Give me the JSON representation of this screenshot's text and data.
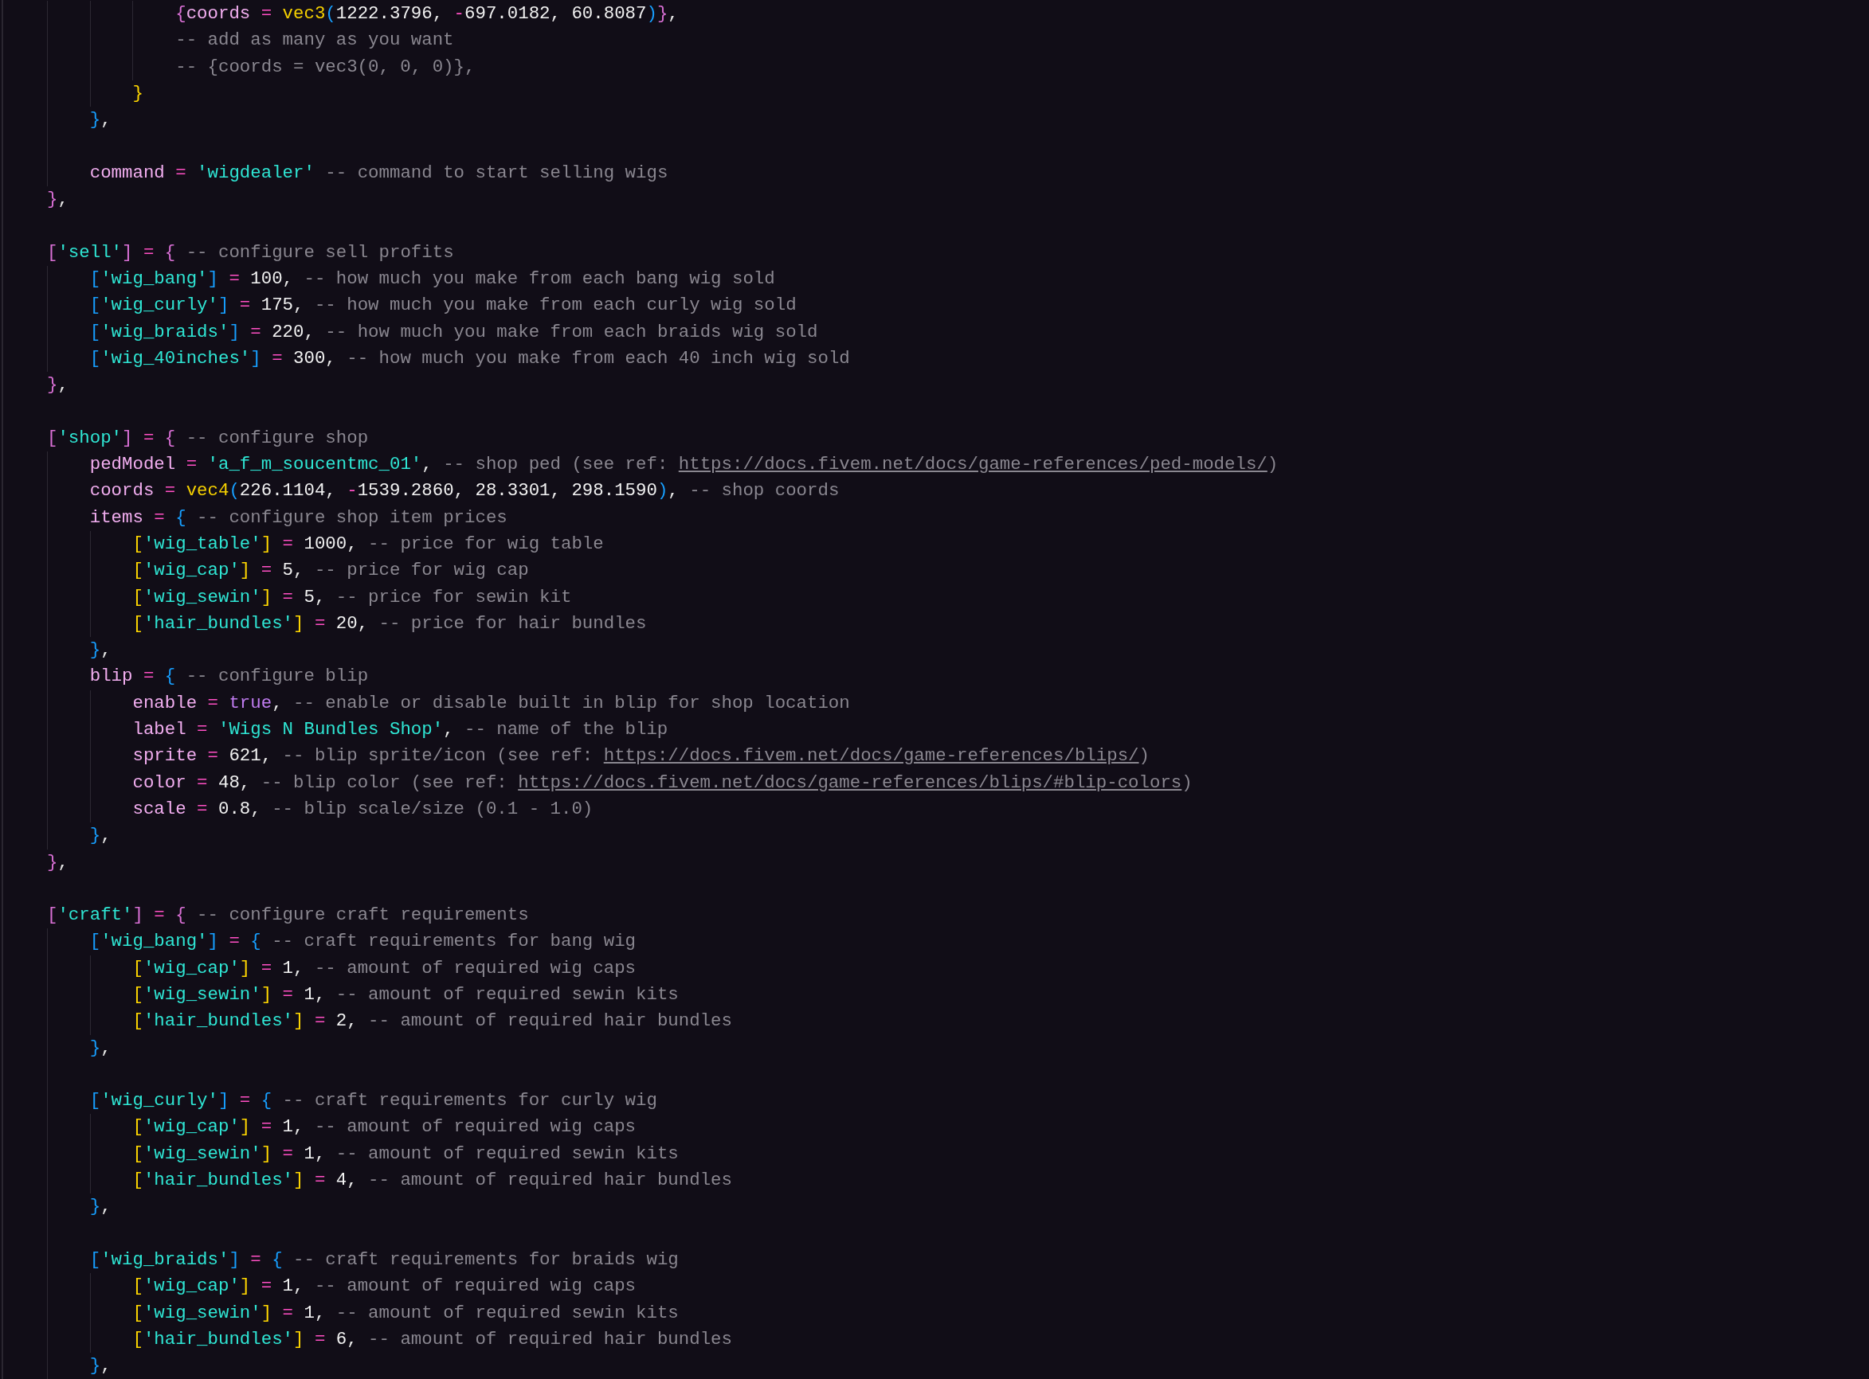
{
  "code": [
    {
      "children": [
        {
          "children": [
            {
              "children": [
                {
                  "tokens": [
                    {
                      "kind": "bracket",
                      "text": "{",
                      "color": "#da70d6"
                    },
                    {
                      "kind": "key",
                      "text": "coords"
                    },
                    {
                      "kind": "op",
                      "text": " = "
                    },
                    {
                      "kind": "func",
                      "text": "vec3"
                    },
                    {
                      "kind": "bracket",
                      "text": "(",
                      "color": "#179fff"
                    },
                    {
                      "kind": "num",
                      "text": "1222.3796"
                    },
                    {
                      "kind": "punct",
                      "text": ", "
                    },
                    {
                      "kind": "op",
                      "text": "-"
                    },
                    {
                      "kind": "num",
                      "text": "697.0182"
                    },
                    {
                      "kind": "punct",
                      "text": ", "
                    },
                    {
                      "kind": "num",
                      "text": "60.8087"
                    },
                    {
                      "kind": "bracket",
                      "text": ")",
                      "color": "#179fff"
                    },
                    {
                      "kind": "bracket",
                      "text": "}",
                      "color": "#da70d6"
                    },
                    {
                      "kind": "punct",
                      "text": ","
                    }
                  ]
                },
                {
                  "tokens": [
                    {
                      "kind": "comment",
                      "text": "-- add as many as you want"
                    }
                  ]
                },
                {
                  "tokens": [
                    {
                      "kind": "comment",
                      "text": "-- {coords = vec3(0, 0, 0)},"
                    }
                  ]
                }
              ]
            },
            {
              "tokens": [
                {
                  "kind": "bracket",
                  "text": "}",
                  "color": "#ffd700"
                }
              ]
            }
          ]
        },
        {
          "tokens": [
            {
              "kind": "bracket",
              "text": "}",
              "color": "#179fff"
            },
            {
              "kind": "punct",
              "text": ","
            }
          ]
        },
        {
          "kind": "blank"
        },
        {
          "tokens": [
            {
              "kind": "key",
              "text": "command"
            },
            {
              "kind": "op",
              "text": " = "
            },
            {
              "kind": "str",
              "text": "'wigdealer'"
            },
            {
              "kind": "comment",
              "text": " -- command to start selling wigs"
            }
          ]
        }
      ]
    },
    {
      "tokens": [
        {
          "kind": "bracket",
          "text": "}",
          "color": "#da70d6"
        },
        {
          "kind": "punct",
          "text": ","
        }
      ]
    },
    {
      "kind": "blank"
    },
    {
      "tokens": [
        {
          "kind": "bracket",
          "text": "[",
          "color": "#da70d6"
        },
        {
          "kind": "str",
          "text": "'sell'"
        },
        {
          "kind": "bracket",
          "text": "]",
          "color": "#da70d6"
        },
        {
          "kind": "op",
          "text": " = "
        },
        {
          "kind": "bracket",
          "text": "{",
          "color": "#da70d6"
        },
        {
          "kind": "comment",
          "text": " -- configure sell profits"
        }
      ],
      "children": [
        {
          "tokens": [
            {
              "kind": "bracket",
              "text": "[",
              "color": "#179fff"
            },
            {
              "kind": "str",
              "text": "'wig_bang'"
            },
            {
              "kind": "bracket",
              "text": "]",
              "color": "#179fff"
            },
            {
              "kind": "op",
              "text": " = "
            },
            {
              "kind": "num",
              "text": "100"
            },
            {
              "kind": "punct",
              "text": ","
            },
            {
              "kind": "comment",
              "text": " -- how much you make from each bang wig sold"
            }
          ]
        },
        {
          "tokens": [
            {
              "kind": "bracket",
              "text": "[",
              "color": "#179fff"
            },
            {
              "kind": "str",
              "text": "'wig_curly'"
            },
            {
              "kind": "bracket",
              "text": "]",
              "color": "#179fff"
            },
            {
              "kind": "op",
              "text": " = "
            },
            {
              "kind": "num",
              "text": "175"
            },
            {
              "kind": "punct",
              "text": ","
            },
            {
              "kind": "comment",
              "text": " -- how much you make from each curly wig sold"
            }
          ]
        },
        {
          "tokens": [
            {
              "kind": "bracket",
              "text": "[",
              "color": "#179fff"
            },
            {
              "kind": "str",
              "text": "'wig_braids'"
            },
            {
              "kind": "bracket",
              "text": "]",
              "color": "#179fff"
            },
            {
              "kind": "op",
              "text": " = "
            },
            {
              "kind": "num",
              "text": "220"
            },
            {
              "kind": "punct",
              "text": ","
            },
            {
              "kind": "comment",
              "text": " -- how much you make from each braids wig sold"
            }
          ]
        },
        {
          "tokens": [
            {
              "kind": "bracket",
              "text": "[",
              "color": "#179fff"
            },
            {
              "kind": "str",
              "text": "'wig_40inches'"
            },
            {
              "kind": "bracket",
              "text": "]",
              "color": "#179fff"
            },
            {
              "kind": "op",
              "text": " = "
            },
            {
              "kind": "num",
              "text": "300"
            },
            {
              "kind": "punct",
              "text": ","
            },
            {
              "kind": "comment",
              "text": " -- how much you make from each 40 inch wig sold"
            }
          ]
        }
      ]
    },
    {
      "tokens": [
        {
          "kind": "bracket",
          "text": "}",
          "color": "#da70d6"
        },
        {
          "kind": "punct",
          "text": ","
        }
      ]
    },
    {
      "kind": "blank"
    },
    {
      "tokens": [
        {
          "kind": "bracket",
          "text": "[",
          "color": "#da70d6"
        },
        {
          "kind": "str",
          "text": "'shop'"
        },
        {
          "kind": "bracket",
          "text": "]",
          "color": "#da70d6"
        },
        {
          "kind": "op",
          "text": " = "
        },
        {
          "kind": "bracket",
          "text": "{",
          "color": "#da70d6"
        },
        {
          "kind": "comment",
          "text": " -- configure shop"
        }
      ],
      "children": [
        {
          "tokens": [
            {
              "kind": "key",
              "text": "pedModel"
            },
            {
              "kind": "op",
              "text": " = "
            },
            {
              "kind": "str",
              "text": "'a_f_m_soucentmc_01'"
            },
            {
              "kind": "punct",
              "text": ","
            },
            {
              "kind": "comment",
              "text": " -- shop ped (see ref: "
            },
            {
              "kind": "link",
              "text": "https://docs.fivem.net/docs/game-references/ped-models/"
            },
            {
              "kind": "comment",
              "text": ")"
            }
          ]
        },
        {
          "tokens": [
            {
              "kind": "key",
              "text": "coords"
            },
            {
              "kind": "op",
              "text": " = "
            },
            {
              "kind": "func",
              "text": "vec4"
            },
            {
              "kind": "bracket",
              "text": "(",
              "color": "#179fff"
            },
            {
              "kind": "num",
              "text": "226.1104"
            },
            {
              "kind": "punct",
              "text": ", "
            },
            {
              "kind": "op",
              "text": "-"
            },
            {
              "kind": "num",
              "text": "1539.2860"
            },
            {
              "kind": "punct",
              "text": ", "
            },
            {
              "kind": "num",
              "text": "28.3301"
            },
            {
              "kind": "punct",
              "text": ", "
            },
            {
              "kind": "num",
              "text": "298.1590"
            },
            {
              "kind": "bracket",
              "text": ")",
              "color": "#179fff"
            },
            {
              "kind": "punct",
              "text": ","
            },
            {
              "kind": "comment",
              "text": " -- shop coords"
            }
          ]
        },
        {
          "tokens": [
            {
              "kind": "key",
              "text": "items"
            },
            {
              "kind": "op",
              "text": " = "
            },
            {
              "kind": "bracket",
              "text": "{",
              "color": "#179fff"
            },
            {
              "kind": "comment",
              "text": " -- configure shop item prices"
            }
          ],
          "children": [
            {
              "tokens": [
                {
                  "kind": "bracket",
                  "text": "[",
                  "color": "#ffd700"
                },
                {
                  "kind": "str",
                  "text": "'wig_table'"
                },
                {
                  "kind": "bracket",
                  "text": "]",
                  "color": "#ffd700"
                },
                {
                  "kind": "op",
                  "text": " = "
                },
                {
                  "kind": "num",
                  "text": "1000"
                },
                {
                  "kind": "punct",
                  "text": ","
                },
                {
                  "kind": "comment",
                  "text": " -- price for wig table"
                }
              ]
            },
            {
              "tokens": [
                {
                  "kind": "bracket",
                  "text": "[",
                  "color": "#ffd700"
                },
                {
                  "kind": "str",
                  "text": "'wig_cap'"
                },
                {
                  "kind": "bracket",
                  "text": "]",
                  "color": "#ffd700"
                },
                {
                  "kind": "op",
                  "text": " = "
                },
                {
                  "kind": "num",
                  "text": "5"
                },
                {
                  "kind": "punct",
                  "text": ","
                },
                {
                  "kind": "comment",
                  "text": " -- price for wig cap"
                }
              ]
            },
            {
              "tokens": [
                {
                  "kind": "bracket",
                  "text": "[",
                  "color": "#ffd700"
                },
                {
                  "kind": "str",
                  "text": "'wig_sewin'"
                },
                {
                  "kind": "bracket",
                  "text": "]",
                  "color": "#ffd700"
                },
                {
                  "kind": "op",
                  "text": " = "
                },
                {
                  "kind": "num",
                  "text": "5"
                },
                {
                  "kind": "punct",
                  "text": ","
                },
                {
                  "kind": "comment",
                  "text": " -- price for sewin kit"
                }
              ]
            },
            {
              "tokens": [
                {
                  "kind": "bracket",
                  "text": "[",
                  "color": "#ffd700"
                },
                {
                  "kind": "str",
                  "text": "'hair_bundles'"
                },
                {
                  "kind": "bracket",
                  "text": "]",
                  "color": "#ffd700"
                },
                {
                  "kind": "op",
                  "text": " = "
                },
                {
                  "kind": "num",
                  "text": "20"
                },
                {
                  "kind": "punct",
                  "text": ","
                },
                {
                  "kind": "comment",
                  "text": " -- price for hair bundles"
                }
              ]
            }
          ]
        },
        {
          "tokens": [
            {
              "kind": "bracket",
              "text": "}",
              "color": "#179fff"
            },
            {
              "kind": "punct",
              "text": ","
            }
          ]
        },
        {
          "tokens": [
            {
              "kind": "key",
              "text": "blip"
            },
            {
              "kind": "op",
              "text": " = "
            },
            {
              "kind": "bracket",
              "text": "{",
              "color": "#179fff"
            },
            {
              "kind": "comment",
              "text": " -- configure blip"
            }
          ],
          "children": [
            {
              "tokens": [
                {
                  "kind": "key",
                  "text": "enable"
                },
                {
                  "kind": "op",
                  "text": " = "
                },
                {
                  "kind": "bool",
                  "text": "true"
                },
                {
                  "kind": "punct",
                  "text": ","
                },
                {
                  "kind": "comment",
                  "text": " -- enable or disable built in blip for shop location"
                }
              ]
            },
            {
              "tokens": [
                {
                  "kind": "key",
                  "text": "label"
                },
                {
                  "kind": "op",
                  "text": " = "
                },
                {
                  "kind": "str",
                  "text": "'Wigs N Bundles Shop'"
                },
                {
                  "kind": "punct",
                  "text": ","
                },
                {
                  "kind": "comment",
                  "text": " -- name of the blip"
                }
              ]
            },
            {
              "tokens": [
                {
                  "kind": "key",
                  "text": "sprite"
                },
                {
                  "kind": "op",
                  "text": " = "
                },
                {
                  "kind": "num",
                  "text": "621"
                },
                {
                  "kind": "punct",
                  "text": ","
                },
                {
                  "kind": "comment",
                  "text": " -- blip sprite/icon (see ref: "
                },
                {
                  "kind": "link",
                  "text": "https://docs.fivem.net/docs/game-references/blips/"
                },
                {
                  "kind": "comment",
                  "text": ")"
                }
              ]
            },
            {
              "tokens": [
                {
                  "kind": "key",
                  "text": "color"
                },
                {
                  "kind": "op",
                  "text": " = "
                },
                {
                  "kind": "num",
                  "text": "48"
                },
                {
                  "kind": "punct",
                  "text": ","
                },
                {
                  "kind": "comment",
                  "text": " -- blip color (see ref: "
                },
                {
                  "kind": "link",
                  "text": "https://docs.fivem.net/docs/game-references/blips/#blip-colors"
                },
                {
                  "kind": "comment",
                  "text": ")"
                }
              ]
            },
            {
              "tokens": [
                {
                  "kind": "key",
                  "text": "scale"
                },
                {
                  "kind": "op",
                  "text": " = "
                },
                {
                  "kind": "num",
                  "text": "0.8"
                },
                {
                  "kind": "punct",
                  "text": ","
                },
                {
                  "kind": "comment",
                  "text": " -- blip scale/size (0.1 - 1.0)"
                }
              ]
            }
          ]
        },
        {
          "tokens": [
            {
              "kind": "bracket",
              "text": "}",
              "color": "#179fff"
            },
            {
              "kind": "punct",
              "text": ","
            }
          ]
        }
      ]
    },
    {
      "tokens": [
        {
          "kind": "bracket",
          "text": "}",
          "color": "#da70d6"
        },
        {
          "kind": "punct",
          "text": ","
        }
      ]
    },
    {
      "kind": "blank"
    },
    {
      "tokens": [
        {
          "kind": "bracket",
          "text": "[",
          "color": "#da70d6"
        },
        {
          "kind": "str",
          "text": "'craft'"
        },
        {
          "kind": "bracket",
          "text": "]",
          "color": "#da70d6"
        },
        {
          "kind": "op",
          "text": " = "
        },
        {
          "kind": "bracket",
          "text": "{",
          "color": "#da70d6"
        },
        {
          "kind": "comment",
          "text": " -- configure craft requirements"
        }
      ],
      "children": [
        {
          "tokens": [
            {
              "kind": "bracket",
              "text": "[",
              "color": "#179fff"
            },
            {
              "kind": "str",
              "text": "'wig_bang'"
            },
            {
              "kind": "bracket",
              "text": "]",
              "color": "#179fff"
            },
            {
              "kind": "op",
              "text": " = "
            },
            {
              "kind": "bracket",
              "text": "{",
              "color": "#179fff"
            },
            {
              "kind": "comment",
              "text": " -- craft requirements for bang wig"
            }
          ],
          "children": [
            {
              "tokens": [
                {
                  "kind": "bracket",
                  "text": "[",
                  "color": "#ffd700"
                },
                {
                  "kind": "str",
                  "text": "'wig_cap'"
                },
                {
                  "kind": "bracket",
                  "text": "]",
                  "color": "#ffd700"
                },
                {
                  "kind": "op",
                  "text": " = "
                },
                {
                  "kind": "num",
                  "text": "1"
                },
                {
                  "kind": "punct",
                  "text": ","
                },
                {
                  "kind": "comment",
                  "text": " -- amount of required wig caps"
                }
              ]
            },
            {
              "tokens": [
                {
                  "kind": "bracket",
                  "text": "[",
                  "color": "#ffd700"
                },
                {
                  "kind": "str",
                  "text": "'wig_sewin'"
                },
                {
                  "kind": "bracket",
                  "text": "]",
                  "color": "#ffd700"
                },
                {
                  "kind": "op",
                  "text": " = "
                },
                {
                  "kind": "num",
                  "text": "1"
                },
                {
                  "kind": "punct",
                  "text": ","
                },
                {
                  "kind": "comment",
                  "text": " -- amount of required sewin kits"
                }
              ]
            },
            {
              "tokens": [
                {
                  "kind": "bracket",
                  "text": "[",
                  "color": "#ffd700"
                },
                {
                  "kind": "str",
                  "text": "'hair_bundles'"
                },
                {
                  "kind": "bracket",
                  "text": "]",
                  "color": "#ffd700"
                },
                {
                  "kind": "op",
                  "text": " = "
                },
                {
                  "kind": "num",
                  "text": "2"
                },
                {
                  "kind": "punct",
                  "text": ","
                },
                {
                  "kind": "comment",
                  "text": " -- amount of required hair bundles"
                }
              ]
            }
          ]
        },
        {
          "tokens": [
            {
              "kind": "bracket",
              "text": "}",
              "color": "#179fff"
            },
            {
              "kind": "punct",
              "text": ","
            }
          ]
        },
        {
          "kind": "blank"
        },
        {
          "tokens": [
            {
              "kind": "bracket",
              "text": "[",
              "color": "#179fff"
            },
            {
              "kind": "str",
              "text": "'wig_curly'"
            },
            {
              "kind": "bracket",
              "text": "]",
              "color": "#179fff"
            },
            {
              "kind": "op",
              "text": " = "
            },
            {
              "kind": "bracket",
              "text": "{",
              "color": "#179fff"
            },
            {
              "kind": "comment",
              "text": " -- craft requirements for curly wig"
            }
          ],
          "children": [
            {
              "tokens": [
                {
                  "kind": "bracket",
                  "text": "[",
                  "color": "#ffd700"
                },
                {
                  "kind": "str",
                  "text": "'wig_cap'"
                },
                {
                  "kind": "bracket",
                  "text": "]",
                  "color": "#ffd700"
                },
                {
                  "kind": "op",
                  "text": " = "
                },
                {
                  "kind": "num",
                  "text": "1"
                },
                {
                  "kind": "punct",
                  "text": ","
                },
                {
                  "kind": "comment",
                  "text": " -- amount of required wig caps"
                }
              ]
            },
            {
              "tokens": [
                {
                  "kind": "bracket",
                  "text": "[",
                  "color": "#ffd700"
                },
                {
                  "kind": "str",
                  "text": "'wig_sewin'"
                },
                {
                  "kind": "bracket",
                  "text": "]",
                  "color": "#ffd700"
                },
                {
                  "kind": "op",
                  "text": " = "
                },
                {
                  "kind": "num",
                  "text": "1"
                },
                {
                  "kind": "punct",
                  "text": ","
                },
                {
                  "kind": "comment",
                  "text": " -- amount of required sewin kits"
                }
              ]
            },
            {
              "tokens": [
                {
                  "kind": "bracket",
                  "text": "[",
                  "color": "#ffd700"
                },
                {
                  "kind": "str",
                  "text": "'hair_bundles'"
                },
                {
                  "kind": "bracket",
                  "text": "]",
                  "color": "#ffd700"
                },
                {
                  "kind": "op",
                  "text": " = "
                },
                {
                  "kind": "num",
                  "text": "4"
                },
                {
                  "kind": "punct",
                  "text": ","
                },
                {
                  "kind": "comment",
                  "text": " -- amount of required hair bundles"
                }
              ]
            }
          ]
        },
        {
          "tokens": [
            {
              "kind": "bracket",
              "text": "}",
              "color": "#179fff"
            },
            {
              "kind": "punct",
              "text": ","
            }
          ]
        },
        {
          "kind": "blank"
        },
        {
          "tokens": [
            {
              "kind": "bracket",
              "text": "[",
              "color": "#179fff"
            },
            {
              "kind": "str",
              "text": "'wig_braids'"
            },
            {
              "kind": "bracket",
              "text": "]",
              "color": "#179fff"
            },
            {
              "kind": "op",
              "text": " = "
            },
            {
              "kind": "bracket",
              "text": "{",
              "color": "#179fff"
            },
            {
              "kind": "comment",
              "text": " -- craft requirements for braids wig"
            }
          ],
          "children": [
            {
              "tokens": [
                {
                  "kind": "bracket",
                  "text": "[",
                  "color": "#ffd700"
                },
                {
                  "kind": "str",
                  "text": "'wig_cap'"
                },
                {
                  "kind": "bracket",
                  "text": "]",
                  "color": "#ffd700"
                },
                {
                  "kind": "op",
                  "text": " = "
                },
                {
                  "kind": "num",
                  "text": "1"
                },
                {
                  "kind": "punct",
                  "text": ","
                },
                {
                  "kind": "comment",
                  "text": " -- amount of required wig caps"
                }
              ]
            },
            {
              "tokens": [
                {
                  "kind": "bracket",
                  "text": "[",
                  "color": "#ffd700"
                },
                {
                  "kind": "str",
                  "text": "'wig_sewin'"
                },
                {
                  "kind": "bracket",
                  "text": "]",
                  "color": "#ffd700"
                },
                {
                  "kind": "op",
                  "text": " = "
                },
                {
                  "kind": "num",
                  "text": "1"
                },
                {
                  "kind": "punct",
                  "text": ","
                },
                {
                  "kind": "comment",
                  "text": " -- amount of required sewin kits"
                }
              ]
            },
            {
              "tokens": [
                {
                  "kind": "bracket",
                  "text": "[",
                  "color": "#ffd700"
                },
                {
                  "kind": "str",
                  "text": "'hair_bundles'"
                },
                {
                  "kind": "bracket",
                  "text": "]",
                  "color": "#ffd700"
                },
                {
                  "kind": "op",
                  "text": " = "
                },
                {
                  "kind": "num",
                  "text": "6"
                },
                {
                  "kind": "punct",
                  "text": ","
                },
                {
                  "kind": "comment",
                  "text": " -- amount of required hair bundles"
                }
              ]
            }
          ]
        },
        {
          "tokens": [
            {
              "kind": "bracket",
              "text": "}",
              "color": "#179fff"
            },
            {
              "kind": "punct",
              "text": ","
            }
          ]
        }
      ]
    }
  ]
}
